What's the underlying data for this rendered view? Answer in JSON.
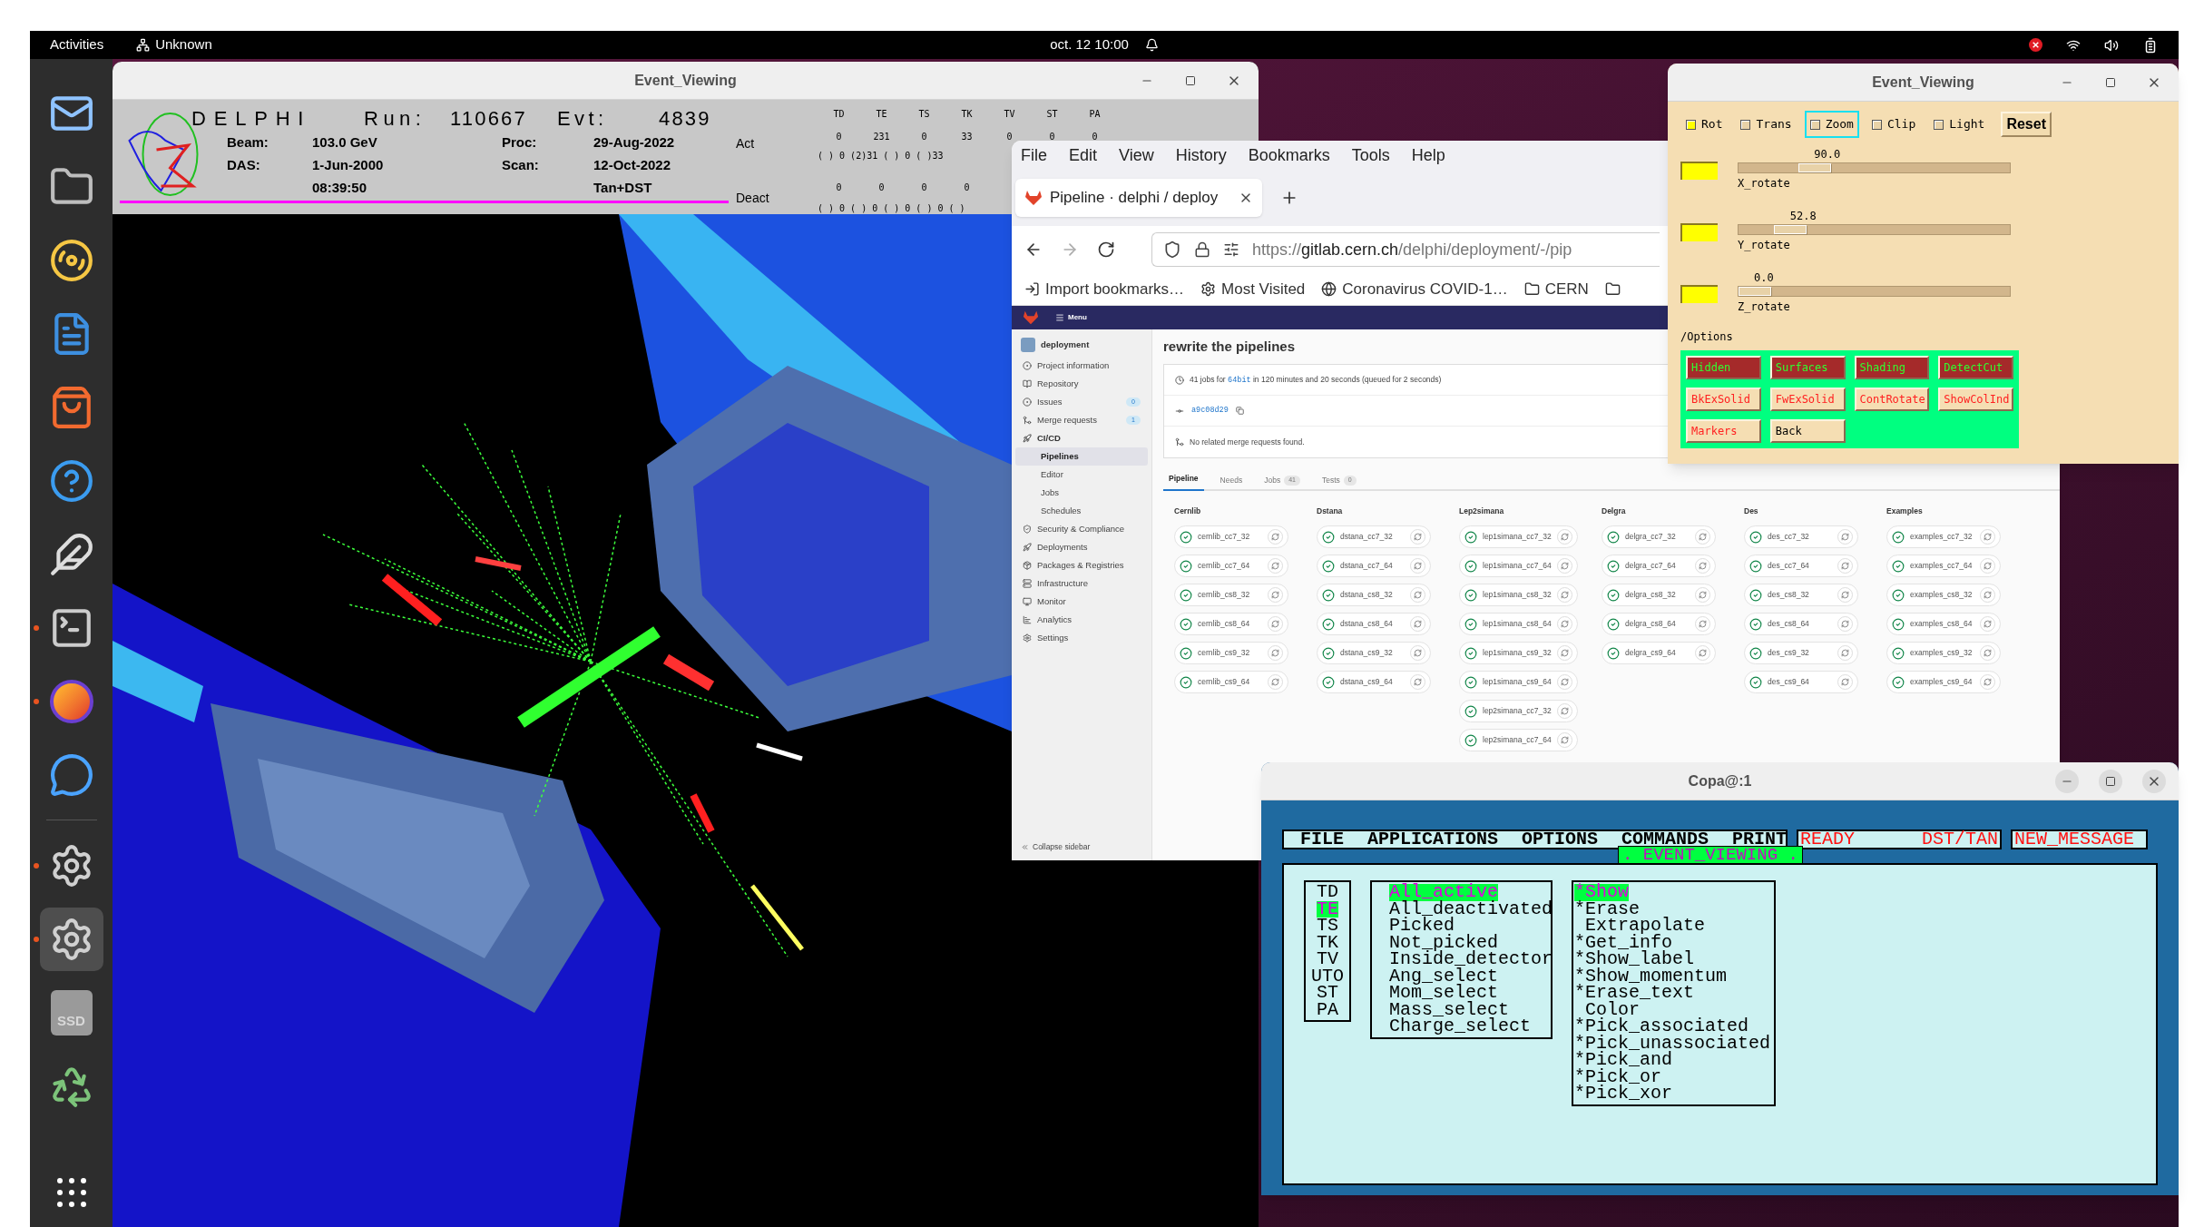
{
  "top_bar": {
    "activities": "Activities",
    "network": "Unknown",
    "clock": "oct. 12 10:00"
  },
  "dock": [
    {
      "kind": "mail",
      "running": false,
      "selected": false
    },
    {
      "kind": "files",
      "running": false,
      "selected": false
    },
    {
      "kind": "music",
      "running": false,
      "selected": false
    },
    {
      "kind": "writer",
      "running": false,
      "selected": false
    },
    {
      "kind": "store",
      "running": false,
      "selected": false
    },
    {
      "kind": "help",
      "running": false,
      "selected": false
    },
    {
      "kind": "app",
      "running": false,
      "selected": false
    },
    {
      "kind": "terminal",
      "running": true,
      "selected": false
    },
    {
      "kind": "browser",
      "running": true,
      "selected": false
    },
    {
      "kind": "chat",
      "running": false,
      "selected": false
    },
    {
      "kind": "settings",
      "running": true,
      "selected": false
    },
    {
      "kind": "settings",
      "running": true,
      "selected": true
    },
    {
      "kind": "drive",
      "label": "SSD",
      "running": false,
      "selected": false
    },
    {
      "kind": "trash",
      "running": false,
      "selected": false
    }
  ],
  "event_viewer": {
    "title": "Event_Viewing",
    "experiment": "DELPHI",
    "run_label": "Run:",
    "run": "110667",
    "evt_label": "Evt:",
    "evt": "4839",
    "rows": [
      {
        "label": "Beam:",
        "value": "103.0 GeV",
        "label2": "Proc:",
        "value2": "29-Aug-2022"
      },
      {
        "label": "DAS:",
        "value": "1-Jun-2000",
        "label2": "Scan:",
        "value2": "12-Oct-2022"
      }
    ],
    "time": "08:39:50",
    "data_type": "Tan+DST",
    "act_label": "Act",
    "deact_label": "Deact",
    "detectors": [
      {
        "label": "TD",
        "act": "0"
      },
      {
        "label": "TE",
        "act": "231"
      },
      {
        "label": "TS",
        "act": "0"
      },
      {
        "label": "TK",
        "act": "33"
      },
      {
        "label": "TV",
        "act": "0"
      },
      {
        "label": "ST",
        "act": "0"
      },
      {
        "label": "PA",
        "act": "0"
      }
    ],
    "act_detail": "( ) 0 (2)31 ( ) 0 ( )33",
    "deact_counts": [
      "0",
      "0",
      "0",
      "0"
    ],
    "deact_detail": "( ) 0 ( ) 0 ( ) 0 ( ) 0 ( )"
  },
  "browser": {
    "menu": [
      "File",
      "Edit",
      "View",
      "History",
      "Bookmarks",
      "Tools",
      "Help"
    ],
    "tab": "Pipeline · delphi / deploy",
    "url": "https://gitlab.cern.ch/delphi/deployment/-/pip",
    "bookmarks": [
      {
        "kind": "import",
        "label": "Import bookmarks…"
      },
      {
        "kind": "gear",
        "label": "Most Visited"
      },
      {
        "kind": "globe",
        "label": "Coronavirus COVID-1…"
      },
      {
        "kind": "folder",
        "label": "CERN"
      }
    ],
    "gitlab": {
      "menu_label": "Menu",
      "project": "deployment",
      "sidebar": [
        {
          "label": "Project information"
        },
        {
          "label": "Repository"
        },
        {
          "label": "Issues",
          "badge": "0"
        },
        {
          "label": "Merge requests",
          "badge": "1"
        },
        {
          "label": "CI/CD",
          "children": [
            {
              "label": "Pipelines",
              "selected": true
            },
            {
              "label": "Editor",
              "selected": false
            },
            {
              "label": "Jobs",
              "selected": false
            },
            {
              "label": "Schedules",
              "selected": false
            }
          ]
        },
        {
          "label": "Security & Compliance"
        },
        {
          "label": "Deployments"
        },
        {
          "label": "Packages & Registries"
        },
        {
          "label": "Infrastructure"
        },
        {
          "label": "Monitor"
        },
        {
          "label": "Analytics"
        },
        {
          "label": "Settings"
        }
      ],
      "collapse": "Collapse sidebar",
      "title": "rewrite the pipelines",
      "summary_prefix": "41 jobs for",
      "branch": "64bit",
      "summary_suffix": "in 120 minutes and 20 seconds (queued for 2 seconds)",
      "commit": "a9c08d29",
      "merge_note": "No related merge requests found.",
      "tabs": [
        {
          "label": "Pipeline",
          "selected": true
        },
        {
          "label": "Needs",
          "selected": false
        },
        {
          "label": "Jobs",
          "count": "41",
          "selected": false
        },
        {
          "label": "Tests",
          "count": "0",
          "selected": false
        }
      ],
      "stages": [
        {
          "name": "Cernlib",
          "jobs": [
            "cernlib_cc7_32",
            "cernlib_cc7_64",
            "cernlib_cs8_32",
            "cernlib_cs8_64",
            "cernlib_cs9_32",
            "cernlib_cs9_64"
          ]
        },
        {
          "name": "Dstana",
          "jobs": [
            "dstana_cc7_32",
            "dstana_cc7_64",
            "dstana_cs8_32",
            "dstana_cs8_64",
            "dstana_cs9_32",
            "dstana_cs9_64"
          ]
        },
        {
          "name": "Lep2simana",
          "jobs": [
            "lep1simana_cc7_32",
            "lep1simana_cc7_64",
            "lep1simana_cs8_32",
            "lep1simana_cs8_64",
            "lep1simana_cs9_32",
            "lep1simana_cs9_64",
            "lep2simana_cc7_32",
            "lep2simana_cc7_64"
          ]
        },
        {
          "name": "Delgra",
          "jobs": [
            "delgra_cc7_32",
            "delgra_cc7_64",
            "delgra_cs8_32",
            "delgra_cs8_64",
            "delgra_cs9_64"
          ]
        },
        {
          "name": "Des",
          "jobs": [
            "des_cc7_32",
            "des_cc7_64",
            "des_cs8_32",
            "des_cs8_64",
            "des_cs9_32",
            "des_cs9_64"
          ]
        },
        {
          "name": "Examples",
          "jobs": [
            "examples_cc7_32",
            "examples_cc7_64",
            "examples_cs8_32",
            "examples_cs8_64",
            "examples_cs9_32",
            "examples_cs9_64"
          ]
        }
      ]
    }
  },
  "controls": {
    "title": "Event_Viewing",
    "toggles": [
      {
        "label": "Rot",
        "checked": true,
        "focused": false
      },
      {
        "label": "Trans",
        "checked": false,
        "focused": false
      },
      {
        "label": "Zoom",
        "checked": false,
        "focused": true
      },
      {
        "label": "Clip",
        "checked": false,
        "focused": false
      },
      {
        "label": "Light",
        "checked": false,
        "focused": false
      }
    ],
    "reset": "Reset",
    "sliders": [
      {
        "value": "90.0",
        "label": "X_rotate",
        "level": 0.25
      },
      {
        "value": "52.8",
        "label": "Y_rotate",
        "level": 0.15
      },
      {
        "value": "0.0",
        "label": "Z_rotate",
        "level": 0
      }
    ],
    "options_label": "/Options",
    "options": [
      {
        "kind": "toggle",
        "label": "Hidden",
        "on": true
      },
      {
        "kind": "toggle",
        "label": "Surfaces",
        "on": true
      },
      {
        "kind": "toggle",
        "label": "Shading",
        "on": true
      },
      {
        "kind": "toggle",
        "label": "DetectCut",
        "on": true
      },
      {
        "kind": "toggle",
        "label": "BkExSolid",
        "on": false
      },
      {
        "kind": "toggle",
        "label": "FwExSolid",
        "on": false
      },
      {
        "kind": "toggle",
        "label": "ContRotate",
        "on": false
      },
      {
        "kind": "toggle",
        "label": "ShowColInd",
        "on": false
      },
      {
        "kind": "toggle",
        "label": "Markers",
        "on": false
      },
      {
        "kind": "action",
        "label": "Back"
      }
    ]
  },
  "copa": {
    "title": "Copa@:1",
    "menu": [
      "FILE",
      "APPLICATIONS",
      "OPTIONS",
      "COMMANDS",
      "PRINT"
    ],
    "status": "READY",
    "mode": "DST/TAN",
    "message": "NEW_MESSAGE",
    "open_menu": ". EVENT_VIEWING .",
    "detectors": [
      {
        "label": "TD",
        "selected": false
      },
      {
        "label": "TE",
        "selected": true
      },
      {
        "label": "TS",
        "selected": false
      },
      {
        "label": "TK",
        "selected": false
      },
      {
        "label": "TV",
        "selected": false
      },
      {
        "label": "UTO",
        "selected": false
      },
      {
        "label": "ST",
        "selected": false
      },
      {
        "label": "PA",
        "selected": false
      }
    ],
    "selections": [
      {
        "label": "All_active",
        "selected": true
      },
      {
        "label": "All_deactivated",
        "selected": false
      },
      {
        "label": "Picked",
        "selected": false
      },
      {
        "label": "Not_picked",
        "selected": false
      },
      {
        "label": "Inside_detector",
        "selected": false
      },
      {
        "label": "Ang_select",
        "selected": false
      },
      {
        "label": "Mom_select",
        "selected": false
      },
      {
        "label": "Mass_select",
        "selected": false
      },
      {
        "label": "Charge_select",
        "selected": false
      }
    ],
    "actions": [
      {
        "label": "*Show",
        "selected": true
      },
      {
        "label": "*Erase",
        "selected": false
      },
      {
        "label": " Extrapolate",
        "selected": false
      },
      {
        "label": "*Get_info",
        "selected": false
      },
      {
        "label": "*Show_label",
        "selected": false
      },
      {
        "label": "*Show_momentum",
        "selected": false
      },
      {
        "label": "*Erase_text",
        "selected": false
      },
      {
        "label": " Color",
        "selected": false
      },
      {
        "label": "*Pick_associated",
        "selected": false
      },
      {
        "label": "*Pick_unassociated",
        "selected": false
      },
      {
        "label": "*Pick_and",
        "selected": false
      },
      {
        "label": "*Pick_or",
        "selected": false
      },
      {
        "label": "*Pick_xor",
        "selected": false
      }
    ]
  }
}
